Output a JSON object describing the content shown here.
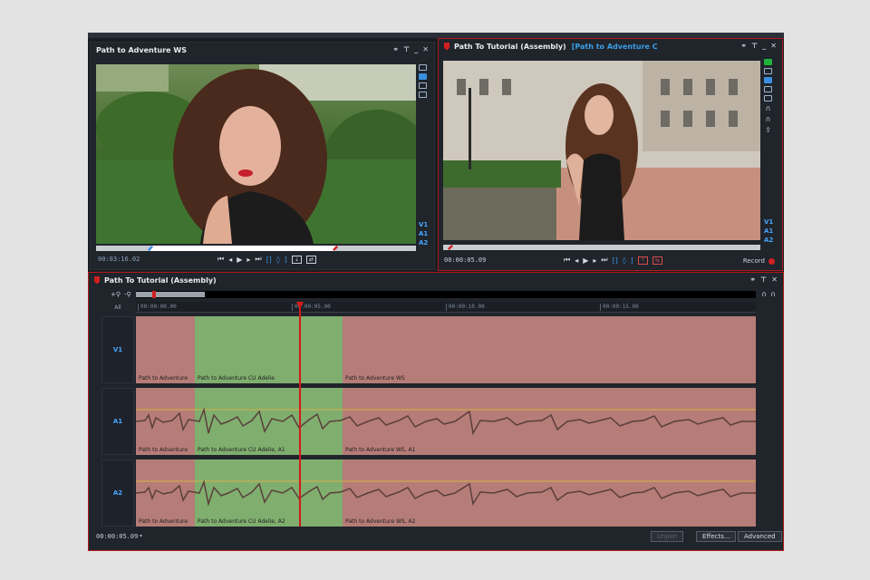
{
  "left_viewer": {
    "title": "Path to Adventure WS",
    "timecode": "00:03:16.02",
    "track_labels": [
      "V1",
      "A1",
      "A2"
    ]
  },
  "right_viewer": {
    "title": "Path To Tutorial (Assembly)",
    "subtitle": "[Path to Adventure C",
    "timecode": "00:00:05.09",
    "track_labels": [
      "V1",
      "A1",
      "A2"
    ],
    "record_label": "Record"
  },
  "timeline": {
    "title": "Path To Tutorial (Assembly)",
    "all_label": "All",
    "ruler_ticks": [
      "00:00:00.00",
      "00:00:05.00",
      "00:00:10.00",
      "00:00:15.00"
    ],
    "tracks": [
      {
        "name": "V1",
        "clips": [
          "Path to Adventure",
          "Path to Adventure CU Adelie",
          "Path to Adventure WS"
        ]
      },
      {
        "name": "A1",
        "clips": [
          "Path to Adventure",
          "Path to Adventure CU Adelie, A1",
          "Path to Adventure WS, A1"
        ]
      },
      {
        "name": "A2",
        "clips": [
          "Path to Adventure",
          "Path to Adventure CU Adelie, A2",
          "Path to Adventure WS, A2"
        ]
      }
    ],
    "timecode": "00:00:05.09",
    "buttons": {
      "unjoin": "Unjoin",
      "effects": "Effects...",
      "advanced": "Advanced"
    }
  },
  "colors": {
    "accent_red": "#d11b1b",
    "clip_red": "#b67c77",
    "clip_green": "#7fae6e",
    "label_blue": "#48a7ff"
  }
}
